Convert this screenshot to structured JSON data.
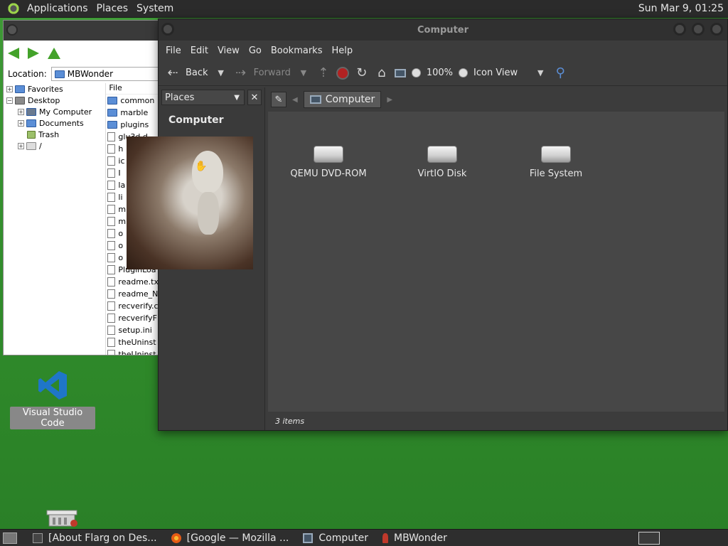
{
  "top_panel": {
    "menus": [
      "Applications",
      "Places",
      "System"
    ],
    "clock": "Sun Mar  9, 01:25"
  },
  "mbwonder": {
    "location_label": "Location:",
    "location_value": "MBWonder",
    "tree": [
      {
        "label": "Favorites",
        "expander": "+"
      },
      {
        "label": "Desktop",
        "expander": "−"
      },
      {
        "label": "My Computer",
        "expander": "+"
      },
      {
        "label": "Documents",
        "expander": "+"
      },
      {
        "label": "Trash",
        "expander": ""
      },
      {
        "label": "/",
        "expander": "+"
      }
    ],
    "list_header": "File",
    "files": [
      {
        "name": "common",
        "kind": "folder"
      },
      {
        "name": "marble",
        "kind": "folder"
      },
      {
        "name": "plugins",
        "kind": "folder"
      },
      {
        "name": "glu3d.d",
        "kind": "file"
      },
      {
        "name": "h",
        "kind": "file"
      },
      {
        "name": "ic",
        "kind": "file"
      },
      {
        "name": "I",
        "kind": "file"
      },
      {
        "name": "la",
        "kind": "file"
      },
      {
        "name": "li",
        "kind": "file"
      },
      {
        "name": "m",
        "kind": "file"
      },
      {
        "name": "m",
        "kind": "file"
      },
      {
        "name": "o",
        "kind": "file"
      },
      {
        "name": "o",
        "kind": "file"
      },
      {
        "name": "o",
        "kind": "file"
      },
      {
        "name": "PluginLoa",
        "kind": "file"
      },
      {
        "name": "readme.tx",
        "kind": "file"
      },
      {
        "name": "readme_N",
        "kind": "file"
      },
      {
        "name": "recverify.c",
        "kind": "file"
      },
      {
        "name": "recverifyF",
        "kind": "file"
      },
      {
        "name": "setup.ini",
        "kind": "file"
      },
      {
        "name": "theUninst",
        "kind": "file"
      },
      {
        "name": "theUninst",
        "kind": "file"
      }
    ]
  },
  "caja": {
    "title": "Computer",
    "menus": [
      "File",
      "Edit",
      "View",
      "Go",
      "Bookmarks",
      "Help"
    ],
    "toolbar": {
      "back": "Back",
      "forward": "Forward",
      "zoom": "100%",
      "view_mode": "Icon View"
    },
    "side_pane": {
      "selector": "Places",
      "section": "Computer"
    },
    "path": "Computer",
    "items": [
      "QEMU DVD-ROM",
      "VirtIO Disk",
      "File System"
    ],
    "status": "3 items"
  },
  "desktop": {
    "icon_label": "Visual Studio Code"
  },
  "taskbar": {
    "tasks": [
      "[About Flarg on Des...",
      "[Google — Mozilla ...",
      "Computer",
      "MBWonder"
    ]
  },
  "colors": {
    "desktop_green": "#3f9a36",
    "panel": "#2b2b2b",
    "window_dark": "#3c3c3c",
    "vscode_blue": "#1f76c8"
  }
}
